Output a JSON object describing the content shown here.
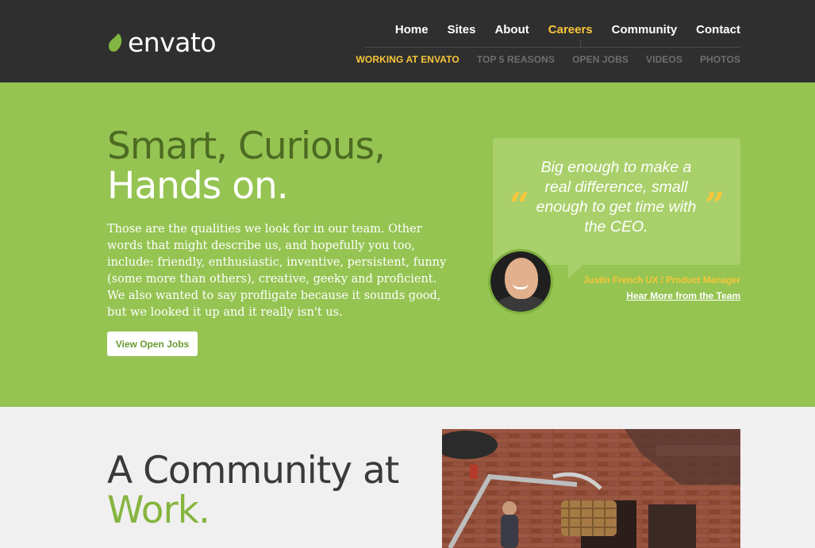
{
  "brand": {
    "name": "envato",
    "accent": "#95c452",
    "highlight": "#f7c63a",
    "dark": "#2f2f2f"
  },
  "nav": {
    "main": [
      {
        "label": "Home",
        "active": false
      },
      {
        "label": "Sites",
        "active": false
      },
      {
        "label": "About",
        "active": false
      },
      {
        "label": "Careers",
        "active": true
      },
      {
        "label": "Community",
        "active": false
      },
      {
        "label": "Contact",
        "active": false
      }
    ],
    "sub": [
      {
        "label": "WORKING AT ENVATO",
        "active": true
      },
      {
        "label": "TOP 5 REASONS",
        "active": false
      },
      {
        "label": "OPEN JOBS",
        "active": false
      },
      {
        "label": "VIDEOS",
        "active": false
      },
      {
        "label": "PHOTOS",
        "active": false
      }
    ]
  },
  "hero": {
    "title_line1": "Smart, Curious,",
    "title_line2": "Hands on.",
    "body": "Those are the qualities we look for in our team. Other words that might describe us, and hopefully you too, include: friendly, enthusiastic, inventive, persistent, funny (some more than others), creative, geeky and proficient. We also wanted to say profligate because it sounds good, but we looked it up and it really isn't us.",
    "button_label": "View Open Jobs"
  },
  "quote": {
    "open_mark": "“",
    "close_mark": "”",
    "text": "Big enough to make a real difference, small enough to get time with the CEO.",
    "author": "Justin French UX / Product Manager",
    "link_label": "Hear More from the Team"
  },
  "community": {
    "title_line1": "A Community at",
    "title_line2": "Work."
  }
}
